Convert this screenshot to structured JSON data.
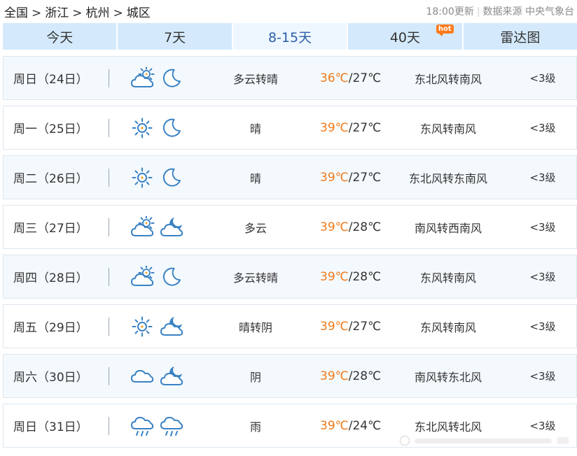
{
  "breadcrumb": [
    "全国",
    "浙江",
    "杭州",
    "城区"
  ],
  "breadcrumb_separator": ">",
  "update_time": "18:00更新",
  "data_source": "数据来源 中央气象台",
  "tabs": [
    {
      "label": "今天",
      "active": false
    },
    {
      "label": "7天",
      "active": false
    },
    {
      "label": "8-15天",
      "active": true
    },
    {
      "label": "40天",
      "active": false,
      "badge": "hot"
    },
    {
      "label": "雷达图",
      "active": false
    }
  ],
  "colors": {
    "tab_bg": "#d4eafc",
    "tab_active_bg": "#eef7ff",
    "high_temp": "#f07a1a",
    "icon": "#3a82c4",
    "sun": "#f3a11b",
    "badge": "#ff7a1a"
  },
  "days": [
    {
      "day": "周日（24日）",
      "day_icon": "partly-cloudy-icon",
      "night_icon": "moon-icon",
      "weather": "多云转晴",
      "high": "36℃",
      "low": "27℃",
      "wind": "东北风转南风",
      "level": "<3级"
    },
    {
      "day": "周一（25日）",
      "day_icon": "sun-icon",
      "night_icon": "moon-icon",
      "weather": "晴",
      "high": "39℃",
      "low": "27℃",
      "wind": "东风转南风",
      "level": "<3级"
    },
    {
      "day": "周二（26日）",
      "day_icon": "sun-icon",
      "night_icon": "moon-icon",
      "weather": "晴",
      "high": "39℃",
      "low": "27℃",
      "wind": "东北风转东南风",
      "level": "<3级"
    },
    {
      "day": "周三（27日）",
      "day_icon": "partly-cloudy-icon",
      "night_icon": "cloudy-night-icon",
      "weather": "多云",
      "high": "39℃",
      "low": "28℃",
      "wind": "南风转西南风",
      "level": "<3级"
    },
    {
      "day": "周四（28日）",
      "day_icon": "partly-cloudy-icon",
      "night_icon": "moon-icon",
      "weather": "多云转晴",
      "high": "39℃",
      "low": "28℃",
      "wind": "东风转南风",
      "level": "<3级"
    },
    {
      "day": "周五（29日）",
      "day_icon": "sun-icon",
      "night_icon": "cloudy-night-icon",
      "weather": "晴转阴",
      "high": "39℃",
      "low": "27℃",
      "wind": "东风转南风",
      "level": "<3级"
    },
    {
      "day": "周六（30日）",
      "day_icon": "cloud-icon",
      "night_icon": "cloudy-night-icon",
      "weather": "阴",
      "high": "39℃",
      "low": "28℃",
      "wind": "南风转东北风",
      "level": "<3级"
    },
    {
      "day": "周日（31日）",
      "day_icon": "rain-icon",
      "night_icon": "rain-icon",
      "weather": "雨",
      "high": "39℃",
      "low": "24℃",
      "wind": "东北风转北风",
      "level": "<3级"
    }
  ]
}
